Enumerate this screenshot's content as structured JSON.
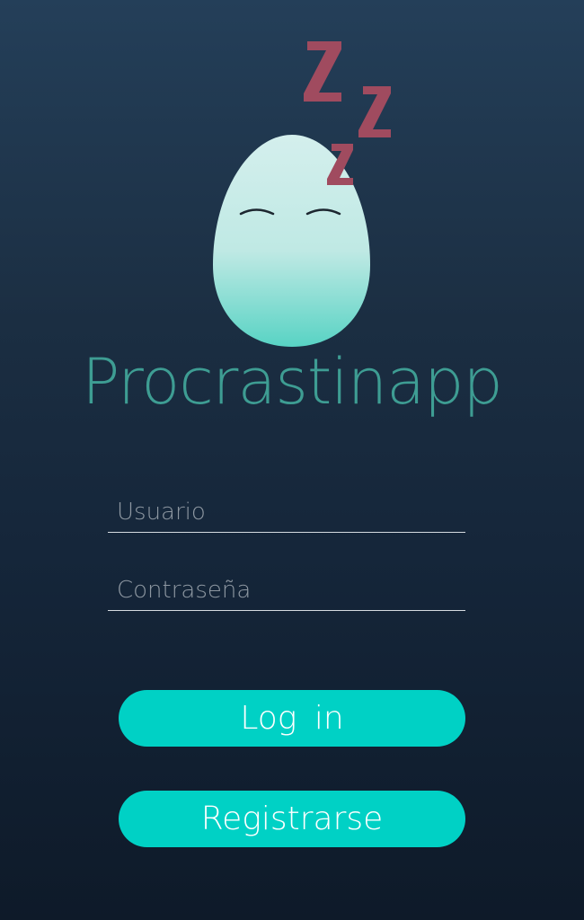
{
  "app": {
    "title": "Procrastinapp",
    "logo_icon": "sleeping-egg-icon",
    "sleep_icon": "zzz-icon"
  },
  "colors": {
    "title": "#3e9d93",
    "button": "#00d1c5",
    "zzz": "#a04b5f",
    "egg": "#ccecea"
  },
  "login_form": {
    "username": {
      "placeholder": "Usuario",
      "value": ""
    },
    "password": {
      "placeholder": "Contraseña",
      "value": ""
    },
    "login_label": "Log in",
    "register_label": "Registrarse"
  }
}
